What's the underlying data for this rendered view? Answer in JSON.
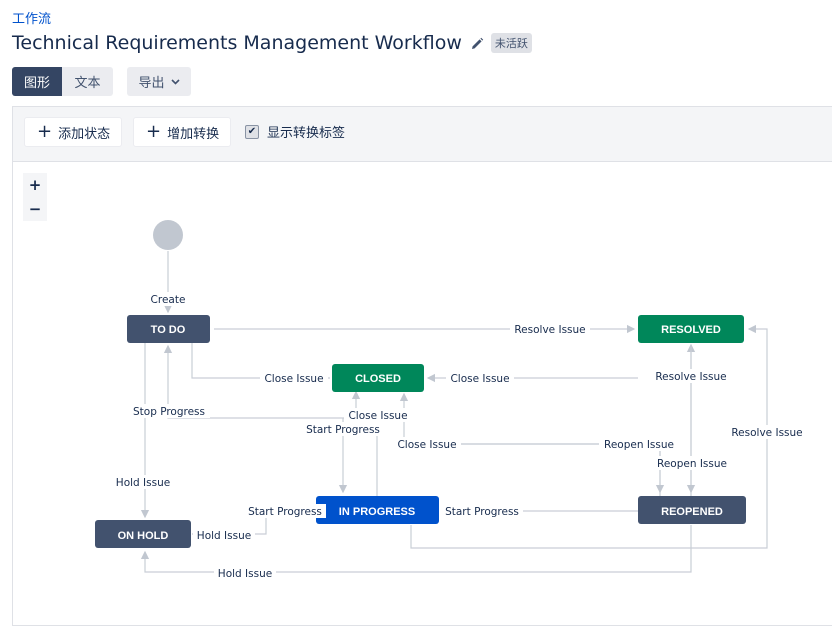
{
  "breadcrumb": "工作流",
  "title": "Technical Requirements Management Workflow",
  "status_badge": "未活跃",
  "toolbar": {
    "diagram": "图形",
    "text": "文本",
    "export": "导出"
  },
  "panel": {
    "add_status": "添加状态",
    "add_transition": "增加转换",
    "show_labels": "显示转换标签",
    "show_labels_checked": true
  },
  "zoom": {
    "in": "+",
    "out": "−"
  },
  "colors": {
    "todo": "#42526e",
    "done": "#00875a",
    "inprogress": "#0052cc",
    "edge": "#c1c7d0",
    "start": "#c1c7d0"
  },
  "nodes": {
    "todo": "TO DO",
    "resolved": "RESOLVED",
    "closed": "CLOSED",
    "in_progress": "IN PROGRESS",
    "reopened": "REOPENED",
    "on_hold": "ON HOLD"
  },
  "edges": {
    "create": "Create",
    "resolve_todo": "Resolve Issue",
    "close_todo": "Close Issue",
    "close_resolved": "Close Issue",
    "resolve_reopened": "Resolve Issue",
    "stop_progress": "Stop Progress",
    "close_inprogress": "Close Issue",
    "start_progress_closed": "Start Progress",
    "close_reopened": "Close Issue",
    "reopen_closed": "Reopen Issue",
    "reopen_resolved": "Reopen Issue",
    "resolve_inprogress": "Resolve Issue",
    "hold_todo": "Hold Issue",
    "start_progress_onhold": "Start Progress",
    "start_progress_reopened": "Start Progress",
    "hold_inprogress": "Hold Issue",
    "hold_reopened": "Hold Issue"
  }
}
